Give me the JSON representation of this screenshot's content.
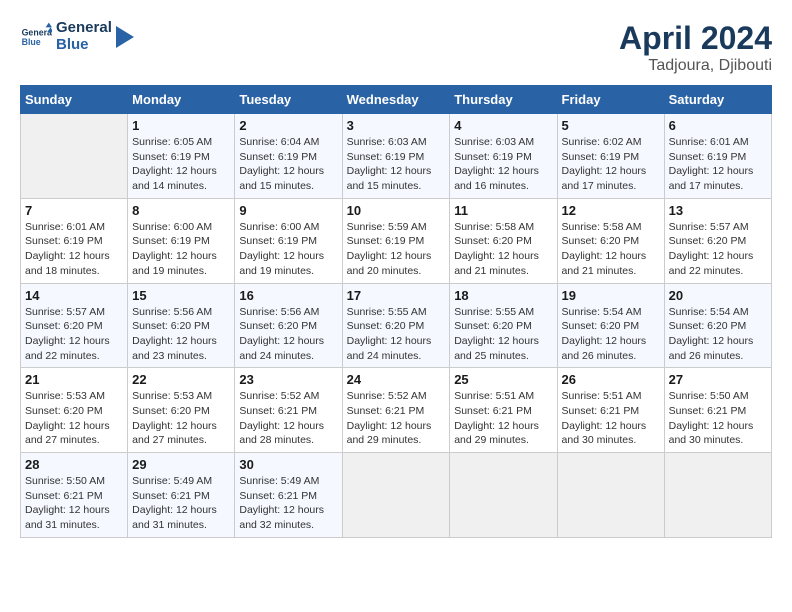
{
  "header": {
    "logo_line1": "General",
    "logo_line2": "Blue",
    "title": "April 2024",
    "subtitle": "Tadjoura, Djibouti"
  },
  "weekdays": [
    "Sunday",
    "Monday",
    "Tuesday",
    "Wednesday",
    "Thursday",
    "Friday",
    "Saturday"
  ],
  "weeks": [
    [
      {
        "day": "",
        "info": ""
      },
      {
        "day": "1",
        "info": "Sunrise: 6:05 AM\nSunset: 6:19 PM\nDaylight: 12 hours\nand 14 minutes."
      },
      {
        "day": "2",
        "info": "Sunrise: 6:04 AM\nSunset: 6:19 PM\nDaylight: 12 hours\nand 15 minutes."
      },
      {
        "day": "3",
        "info": "Sunrise: 6:03 AM\nSunset: 6:19 PM\nDaylight: 12 hours\nand 15 minutes."
      },
      {
        "day": "4",
        "info": "Sunrise: 6:03 AM\nSunset: 6:19 PM\nDaylight: 12 hours\nand 16 minutes."
      },
      {
        "day": "5",
        "info": "Sunrise: 6:02 AM\nSunset: 6:19 PM\nDaylight: 12 hours\nand 17 minutes."
      },
      {
        "day": "6",
        "info": "Sunrise: 6:01 AM\nSunset: 6:19 PM\nDaylight: 12 hours\nand 17 minutes."
      }
    ],
    [
      {
        "day": "7",
        "info": "Sunrise: 6:01 AM\nSunset: 6:19 PM\nDaylight: 12 hours\nand 18 minutes."
      },
      {
        "day": "8",
        "info": "Sunrise: 6:00 AM\nSunset: 6:19 PM\nDaylight: 12 hours\nand 19 minutes."
      },
      {
        "day": "9",
        "info": "Sunrise: 6:00 AM\nSunset: 6:19 PM\nDaylight: 12 hours\nand 19 minutes."
      },
      {
        "day": "10",
        "info": "Sunrise: 5:59 AM\nSunset: 6:19 PM\nDaylight: 12 hours\nand 20 minutes."
      },
      {
        "day": "11",
        "info": "Sunrise: 5:58 AM\nSunset: 6:20 PM\nDaylight: 12 hours\nand 21 minutes."
      },
      {
        "day": "12",
        "info": "Sunrise: 5:58 AM\nSunset: 6:20 PM\nDaylight: 12 hours\nand 21 minutes."
      },
      {
        "day": "13",
        "info": "Sunrise: 5:57 AM\nSunset: 6:20 PM\nDaylight: 12 hours\nand 22 minutes."
      }
    ],
    [
      {
        "day": "14",
        "info": "Sunrise: 5:57 AM\nSunset: 6:20 PM\nDaylight: 12 hours\nand 22 minutes."
      },
      {
        "day": "15",
        "info": "Sunrise: 5:56 AM\nSunset: 6:20 PM\nDaylight: 12 hours\nand 23 minutes."
      },
      {
        "day": "16",
        "info": "Sunrise: 5:56 AM\nSunset: 6:20 PM\nDaylight: 12 hours\nand 24 minutes."
      },
      {
        "day": "17",
        "info": "Sunrise: 5:55 AM\nSunset: 6:20 PM\nDaylight: 12 hours\nand 24 minutes."
      },
      {
        "day": "18",
        "info": "Sunrise: 5:55 AM\nSunset: 6:20 PM\nDaylight: 12 hours\nand 25 minutes."
      },
      {
        "day": "19",
        "info": "Sunrise: 5:54 AM\nSunset: 6:20 PM\nDaylight: 12 hours\nand 26 minutes."
      },
      {
        "day": "20",
        "info": "Sunrise: 5:54 AM\nSunset: 6:20 PM\nDaylight: 12 hours\nand 26 minutes."
      }
    ],
    [
      {
        "day": "21",
        "info": "Sunrise: 5:53 AM\nSunset: 6:20 PM\nDaylight: 12 hours\nand 27 minutes."
      },
      {
        "day": "22",
        "info": "Sunrise: 5:53 AM\nSunset: 6:20 PM\nDaylight: 12 hours\nand 27 minutes."
      },
      {
        "day": "23",
        "info": "Sunrise: 5:52 AM\nSunset: 6:21 PM\nDaylight: 12 hours\nand 28 minutes."
      },
      {
        "day": "24",
        "info": "Sunrise: 5:52 AM\nSunset: 6:21 PM\nDaylight: 12 hours\nand 29 minutes."
      },
      {
        "day": "25",
        "info": "Sunrise: 5:51 AM\nSunset: 6:21 PM\nDaylight: 12 hours\nand 29 minutes."
      },
      {
        "day": "26",
        "info": "Sunrise: 5:51 AM\nSunset: 6:21 PM\nDaylight: 12 hours\nand 30 minutes."
      },
      {
        "day": "27",
        "info": "Sunrise: 5:50 AM\nSunset: 6:21 PM\nDaylight: 12 hours\nand 30 minutes."
      }
    ],
    [
      {
        "day": "28",
        "info": "Sunrise: 5:50 AM\nSunset: 6:21 PM\nDaylight: 12 hours\nand 31 minutes."
      },
      {
        "day": "29",
        "info": "Sunrise: 5:49 AM\nSunset: 6:21 PM\nDaylight: 12 hours\nand 31 minutes."
      },
      {
        "day": "30",
        "info": "Sunrise: 5:49 AM\nSunset: 6:21 PM\nDaylight: 12 hours\nand 32 minutes."
      },
      {
        "day": "",
        "info": ""
      },
      {
        "day": "",
        "info": ""
      },
      {
        "day": "",
        "info": ""
      },
      {
        "day": "",
        "info": ""
      }
    ]
  ]
}
